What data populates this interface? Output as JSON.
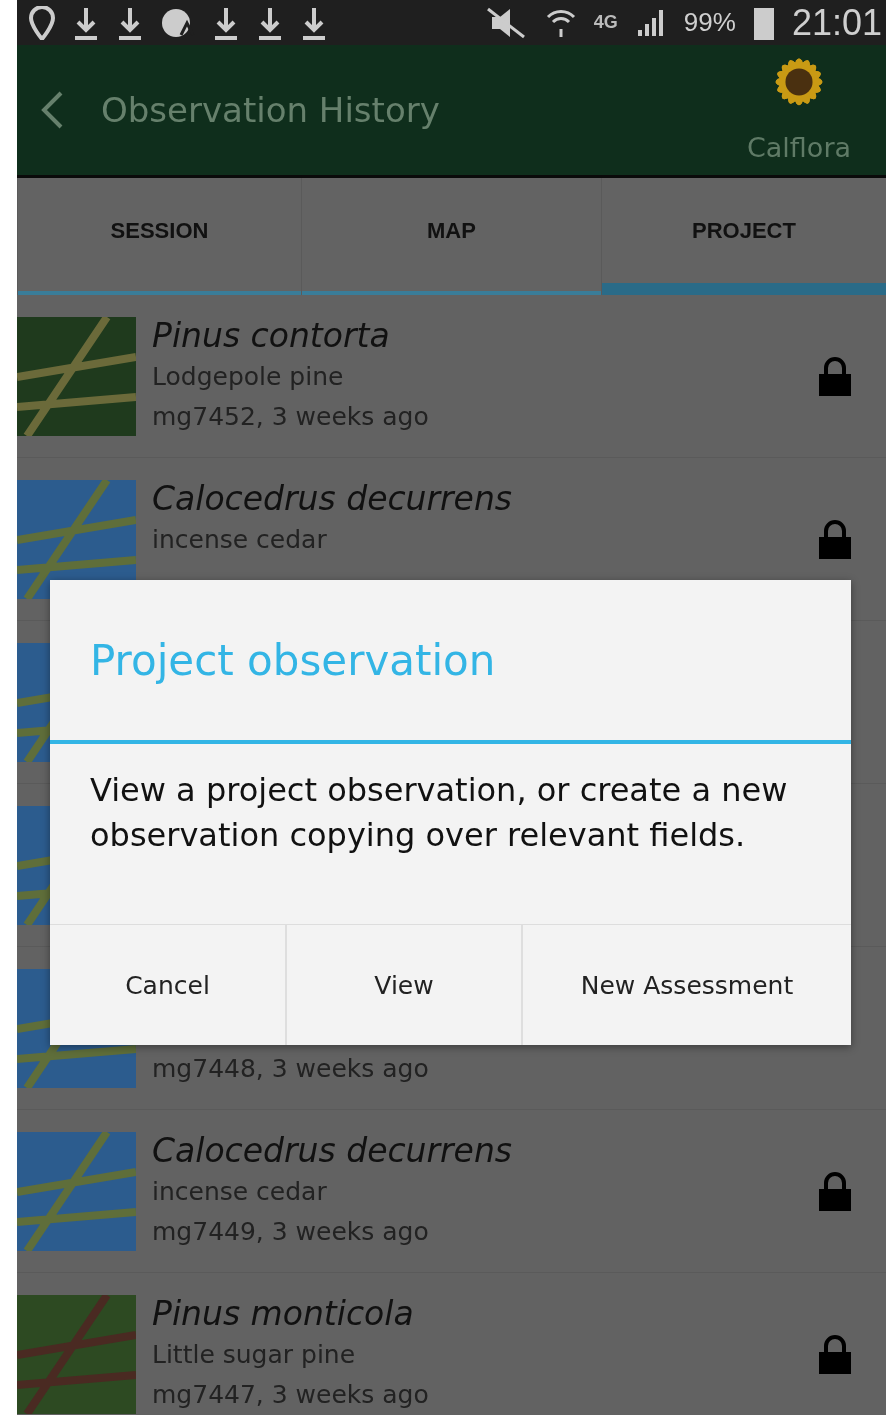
{
  "status_bar": {
    "battery": "99%",
    "network": "4G",
    "time": "21:01"
  },
  "app_bar": {
    "title": "Observation History",
    "logo_caption": "Calflora"
  },
  "tabs": [
    {
      "label": "SESSION",
      "selected": false
    },
    {
      "label": "MAP",
      "selected": false
    },
    {
      "label": "PROJECT",
      "selected": true
    }
  ],
  "observations": [
    {
      "kind": "pine",
      "name": "Pinus contorta",
      "common": "Lodgepole pine",
      "meta": "mg7452, 3 weeks ago",
      "locked": true
    },
    {
      "kind": "cedar",
      "name": "Calocedrus decurrens",
      "common": "incense cedar",
      "locked": true
    },
    {
      "kind": "cedar"
    },
    {
      "kind": "cedar"
    },
    {
      "kind": "cedar",
      "meta": "mg7448, 3 weeks ago"
    },
    {
      "kind": "cedar",
      "name": "Calocedrus decurrens",
      "common": "incense cedar",
      "meta": "mg7449, 3 weeks ago",
      "locked": true
    },
    {
      "kind": "cone",
      "name": "Pinus monticola",
      "common": "Little sugar pine",
      "meta": "mg7447, 3 weeks ago",
      "locked": true
    }
  ],
  "dialog": {
    "title": "Project observation",
    "message": "View a project observation, or create a new observation copying over relevant fields.",
    "buttons": [
      "Cancel",
      "View",
      "New Assessment"
    ]
  }
}
